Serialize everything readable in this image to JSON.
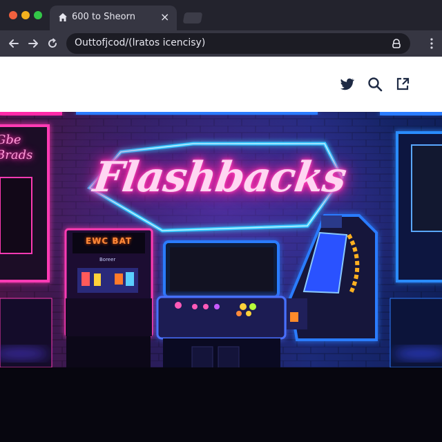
{
  "browser": {
    "tab": {
      "title": "600 to Sheorn",
      "close_glyph": "×"
    },
    "address_bar": {
      "url": "Outtofjcod/(lratos icencisy)"
    },
    "icons": [
      "home-icon",
      "back-arrow-icon",
      "forward-arrow-icon",
      "reload-icon",
      "lock-icon",
      "menu-dots-icon"
    ]
  },
  "header": {
    "icons": [
      "twitter-icon",
      "search-icon",
      "share-icon"
    ]
  },
  "hero": {
    "title": "Flashbacks",
    "left_sign": "Gbe\nBrads",
    "marquee": "EWC  BAT",
    "cabinet_label": "Boreer"
  },
  "colors": {
    "neon_pink": "#ff2aa8",
    "neon_blue": "#2b7bff",
    "neon_cyan": "#34c8ff",
    "chrome_dark": "#23232d",
    "header_bg": "#ffffff"
  }
}
